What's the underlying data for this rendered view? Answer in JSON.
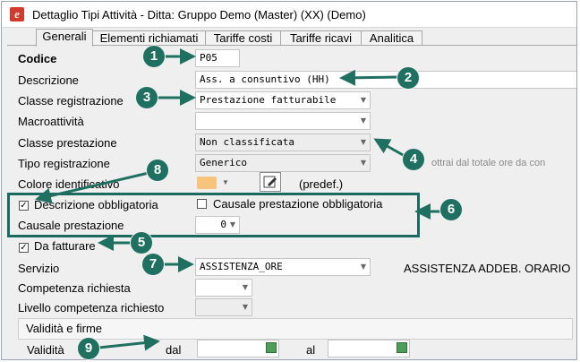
{
  "window": {
    "title": "Dettaglio Tipi Attività - Ditta: Gruppo Demo (Master) (XX) (Demo)"
  },
  "tabs": [
    {
      "label": "Generali",
      "active": true
    },
    {
      "label": "Elementi richiamati"
    },
    {
      "label": "Tariffe costi"
    },
    {
      "label": "Tariffe ricavi"
    },
    {
      "label": "Analitica"
    }
  ],
  "form": {
    "codice_label": "Codice",
    "codice_value": "P05",
    "descrizione_label": "Descrizione",
    "descrizione_value": "Ass. a consuntivo (HH)",
    "classe_registrazione_label": "Classe registrazione",
    "classe_registrazione_value": "Prestazione fatturabile",
    "macroattivita_label": "Macroattività",
    "macroattivita_value": "",
    "classe_prestazione_label": "Classe prestazione",
    "classe_prestazione_value": "Non classificata",
    "tipo_registrazione_label": "Tipo registrazione",
    "tipo_registrazione_value": "Generico",
    "tipo_registrazione_note": "ottrai dal totale ore da con",
    "colore_label": "Colore identificativo",
    "colore_value": "#f6c47a",
    "colore_note": "(predef.)",
    "descrizione_obbl_label": "Descrizione obbligatoria",
    "descrizione_obbl_checked": true,
    "causale_obbl_label": "Causale prestazione obbligatoria",
    "causale_obbl_checked": false,
    "causale_label": "Causale prestazione",
    "causale_value": "0",
    "da_fatturare_label": "Da fatturare",
    "da_fatturare_checked": true,
    "servizio_label": "Servizio",
    "servizio_value": "ASSISTENZA_ORE",
    "servizio_desc": "ASSISTENZA ADDEB. ORARIO",
    "competenza_label": "Competenza richiesta",
    "livello_label": "Livello competenza richiesto"
  },
  "validity": {
    "section_title": "Validità e firme",
    "validita_label": "Validità",
    "dal_label": "dal",
    "al_label": "al",
    "dal_value": "",
    "al_value": ""
  },
  "callouts": [
    "1",
    "2",
    "3",
    "4",
    "5",
    "6",
    "7",
    "8",
    "9"
  ],
  "icons": {
    "app": "e",
    "color_picker": "pencil-icon",
    "calendar": "calendar-icon"
  },
  "colors": {
    "callout": "#1f7060",
    "highlight_border": "#1b6a5f"
  }
}
